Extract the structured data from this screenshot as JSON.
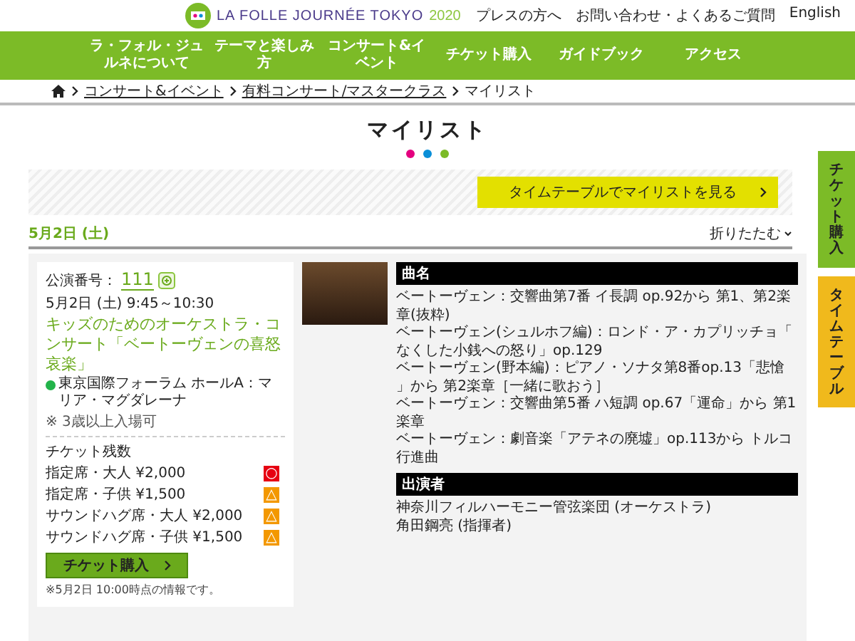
{
  "header": {
    "logo_text": "LA FOLLE JOURNÉE TOKYO",
    "logo_year": "2020",
    "links": [
      "プレスの方へ",
      "お問い合わせ・よくあるご質問",
      "English"
    ]
  },
  "nav": [
    "ラ・フォル・ジュルネについて",
    "テーマと楽しみ方",
    "コンサート&イベント",
    "チケット購入",
    "ガイドブック",
    "アクセス"
  ],
  "breadcrumb": [
    {
      "label": "コンサート&イベント",
      "link": true
    },
    {
      "label": "有料コンサート/マスタークラス",
      "link": true
    },
    {
      "label": "マイリスト",
      "link": false
    }
  ],
  "page_title": "マイリスト",
  "dots": [
    {
      "color": "#e4007f"
    },
    {
      "color": "#0a8fd8"
    },
    {
      "color": "#7cbb27"
    }
  ],
  "timetable_button": "タイムテーブルでマイリストを見る",
  "date": "5月2日 (土)",
  "collapse": "折りたたむ",
  "concert": {
    "number_label": "公演番号：",
    "number": "111",
    "time": "5月2日 (土) 9:45～10:30",
    "title": "キッズのためのオーケストラ・コンサート「ベートーヴェンの喜怒哀楽」",
    "venue": {
      "color": "#22b34a",
      "name": "東京国際フォーラム ホールA：マリア・マグダレーナ"
    },
    "note": "※ 3歳以上入場可",
    "tickets_label": "チケット残数",
    "tickets": [
      {
        "label": "指定席・大人 ¥2,000",
        "mark": "○",
        "color": "#e60012"
      },
      {
        "label": "指定席・子供 ¥1,500",
        "mark": "△",
        "color": "#f39800"
      },
      {
        "label": "サウンドハグ席・大人 ¥2,000",
        "mark": "△",
        "color": "#f39800"
      },
      {
        "label": "サウンドハグ席・子供 ¥1,500",
        "mark": "△",
        "color": "#f39800"
      }
    ],
    "buy_button": "チケット購入",
    "footnote": "※5月2日 10:00時点の情報です。",
    "program_heading": "曲名",
    "program": [
      "ベートーヴェン：交響曲第7番 イ長調 op.92から 第1、第2楽章(抜粋)",
      "ベートーヴェン(シュルホフ編)：ロンド・ア・カプリッチョ「なくした小銭への怒り」op.129",
      "ベートーヴェン(野本編)：ピアノ・ソナタ第8番op.13「悲愴」から 第2楽章［一緒に歌おう］",
      "ベートーヴェン：交響曲第5番 ハ短調 op.67「運命」から 第1楽章",
      "ベートーヴェン：劇音楽「アテネの廃墟」op.113から トルコ行進曲"
    ],
    "performers_heading": "出演者",
    "performers": [
      "神奈川フィルハーモニー管弦楽団 (オーケストラ)",
      "角田鋼亮 (指揮者)"
    ]
  },
  "side_tabs": [
    {
      "label": "チケット購入",
      "color": "#7cbb27"
    },
    {
      "label": "タイムテーブル",
      "color": "#f0b91c"
    }
  ]
}
